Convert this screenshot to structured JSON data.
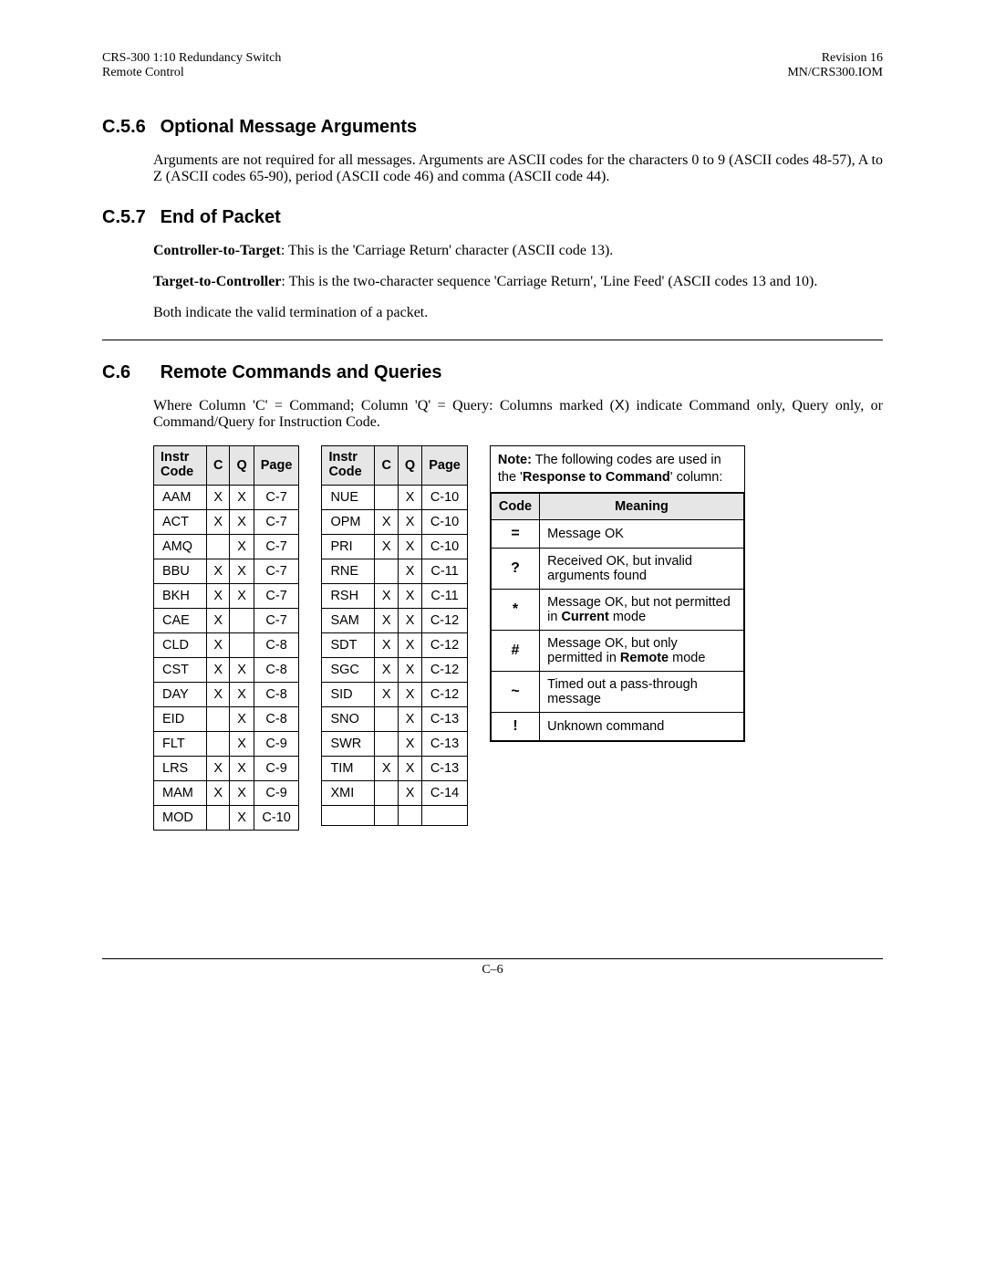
{
  "header": {
    "left1": "CRS-300 1:10 Redundancy Switch",
    "left2": "Remote Control",
    "right1": "Revision 16",
    "right2": "MN/CRS300.IOM"
  },
  "sections": {
    "s1": {
      "num": "C.5.6",
      "title": "Optional Message Arguments"
    },
    "s2": {
      "num": "C.5.7",
      "title": "End of Packet"
    },
    "s3": {
      "num": "C.6",
      "title": "Remote Commands and Queries"
    }
  },
  "paragraphs": {
    "p1": "Arguments are not required for all messages. Arguments are ASCII codes for the characters 0 to 9 (ASCII codes 48-57), A to Z (ASCII codes 65-90), period (ASCII code 46) and comma (ASCII code 44).",
    "p2_label": "Controller-to-Target",
    "p2_rest": ": This is the 'Carriage Return' character (ASCII code 13).",
    "p3_label": "Target-to-Controller",
    "p3_rest": ": This is the two-character sequence 'Carriage Return', 'Line Feed' (ASCII codes 13 and 10).",
    "p4": "Both indicate the valid termination of a packet.",
    "p5_a": "Where Column 'C' = Command; Column 'Q' = Query: Columns marked (",
    "p5_mark": "X",
    "p5_b": ") indicate Command only, Query only, or Command/Query for Instruction Code."
  },
  "table_headers": {
    "instr": "Instr Code",
    "c": "C",
    "q": "Q",
    "page": "Page"
  },
  "table1": [
    {
      "code": "AAM",
      "c": "X",
      "q": "X",
      "page": "C-7"
    },
    {
      "code": "ACT",
      "c": "X",
      "q": "X",
      "page": "C-7"
    },
    {
      "code": "AMQ",
      "c": "",
      "q": "X",
      "page": "C-7"
    },
    {
      "code": "BBU",
      "c": "X",
      "q": "X",
      "page": "C-7"
    },
    {
      "code": "BKH",
      "c": "X",
      "q": "X",
      "page": "C-7"
    },
    {
      "code": "CAE",
      "c": "X",
      "q": "",
      "page": "C-7"
    },
    {
      "code": "CLD",
      "c": "X",
      "q": "",
      "page": "C-8"
    },
    {
      "code": "CST",
      "c": "X",
      "q": "X",
      "page": "C-8"
    },
    {
      "code": "DAY",
      "c": "X",
      "q": "X",
      "page": "C-8"
    },
    {
      "code": "EID",
      "c": "",
      "q": "X",
      "page": "C-8"
    },
    {
      "code": "FLT",
      "c": "",
      "q": "X",
      "page": "C-9"
    },
    {
      "code": "LRS",
      "c": "X",
      "q": "X",
      "page": "C-9"
    },
    {
      "code": "MAM",
      "c": "X",
      "q": "X",
      "page": "C-9"
    },
    {
      "code": "MOD",
      "c": "",
      "q": "X",
      "page": "C-10"
    }
  ],
  "table2": [
    {
      "code": "NUE",
      "c": "",
      "q": "X",
      "page": "C-10"
    },
    {
      "code": "OPM",
      "c": "X",
      "q": "X",
      "page": "C-10"
    },
    {
      "code": "PRI",
      "c": "X",
      "q": "X",
      "page": "C-10"
    },
    {
      "code": "RNE",
      "c": "",
      "q": "X",
      "page": "C-11"
    },
    {
      "code": "RSH",
      "c": "X",
      "q": "X",
      "page": "C-11"
    },
    {
      "code": "SAM",
      "c": "X",
      "q": "X",
      "page": "C-12"
    },
    {
      "code": "SDT",
      "c": "X",
      "q": "X",
      "page": "C-12"
    },
    {
      "code": "SGC",
      "c": "X",
      "q": "X",
      "page": "C-12"
    },
    {
      "code": "SID",
      "c": "X",
      "q": "X",
      "page": "C-12"
    },
    {
      "code": "SNO",
      "c": "",
      "q": "X",
      "page": "C-13"
    },
    {
      "code": "SWR",
      "c": "",
      "q": "X",
      "page": "C-13"
    },
    {
      "code": "TIM",
      "c": "X",
      "q": "X",
      "page": "C-13"
    },
    {
      "code": "XMI",
      "c": "",
      "q": "X",
      "page": "C-14"
    },
    {
      "code": "",
      "c": "",
      "q": "",
      "page": ""
    }
  ],
  "note": {
    "label": "Note:",
    "text_a": "The following codes are used in the '",
    "text_bold": "Response to Command",
    "text_b": "' column:"
  },
  "codes_header": {
    "code": "Code",
    "meaning": "Meaning"
  },
  "codes": [
    {
      "sym": "=",
      "mean_a": "Message OK",
      "bold": "",
      "mean_b": ""
    },
    {
      "sym": "?",
      "mean_a": "Received OK, but invalid arguments found",
      "bold": "",
      "mean_b": ""
    },
    {
      "sym": "*",
      "mean_a": "Message OK, but not permitted in ",
      "bold": "Current",
      "mean_b": " mode"
    },
    {
      "sym": "#",
      "mean_a": "Message OK, but only permitted in ",
      "bold": "Remote",
      "mean_b": " mode"
    },
    {
      "sym": "~",
      "mean_a": "Timed out a pass-through message",
      "bold": "",
      "mean_b": ""
    },
    {
      "sym": "!",
      "mean_a": "Unknown command",
      "bold": "",
      "mean_b": ""
    }
  ],
  "footer": "C–6"
}
